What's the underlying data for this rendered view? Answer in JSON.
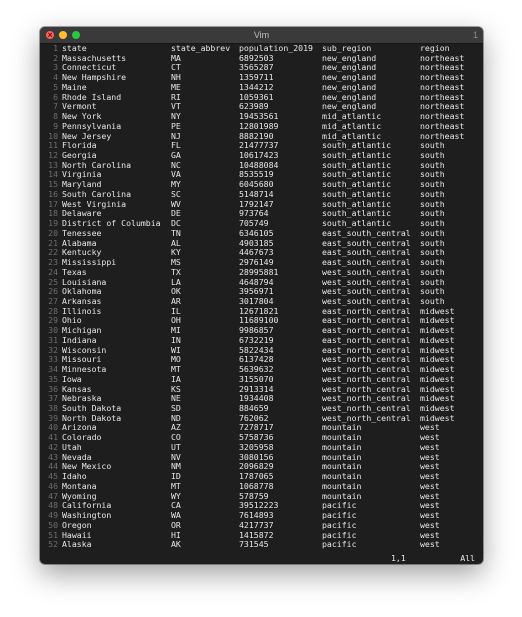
{
  "window": {
    "title": "Vim",
    "tab_number": "1"
  },
  "buffer": {
    "lines": [
      [
        "state",
        "state_abbrev",
        "population_2019",
        "sub_region",
        "region"
      ],
      [
        "Massachusetts",
        "MA",
        "6892503",
        "new_england",
        "northeast"
      ],
      [
        "Connecticut",
        "CT",
        "3565287",
        "new_england",
        "northeast"
      ],
      [
        "New Hampshire",
        "NH",
        "1359711",
        "new_england",
        "northeast"
      ],
      [
        "Maine",
        "ME",
        "1344212",
        "new_england",
        "northeast"
      ],
      [
        "Rhode Island",
        "RI",
        "1059361",
        "new_england",
        "northeast"
      ],
      [
        "Vermont",
        "VT",
        "623989",
        "new_england",
        "northeast"
      ],
      [
        "New York",
        "NY",
        "19453561",
        "mid_atlantic",
        "northeast"
      ],
      [
        "Pennsylvania",
        "PE",
        "12801989",
        "mid_atlantic",
        "northeast"
      ],
      [
        "New Jersey",
        "NJ",
        "8882190",
        "mid_atlantic",
        "northeast"
      ],
      [
        "Florida",
        "FL",
        "21477737",
        "south_atlantic",
        "south"
      ],
      [
        "Georgia",
        "GA",
        "10617423",
        "south_atlantic",
        "south"
      ],
      [
        "North Carolina",
        "NC",
        "10488084",
        "south_atlantic",
        "south"
      ],
      [
        "Virginia",
        "VA",
        "8535519",
        "south_atlantic",
        "south"
      ],
      [
        "Maryland",
        "MY",
        "6045680",
        "south_atlantic",
        "south"
      ],
      [
        "South Carolina",
        "SC",
        "5148714",
        "south_atlantic",
        "south"
      ],
      [
        "West Virginia",
        "WV",
        "1792147",
        "south_atlantic",
        "south"
      ],
      [
        "Delaware",
        "DE",
        "973764",
        "south_atlantic",
        "south"
      ],
      [
        "District of Columbia",
        "DC",
        "705749",
        "south_atlantic",
        "south"
      ],
      [
        "Tenessee",
        "TN",
        "6346105",
        "east_south_central",
        "south"
      ],
      [
        "Alabama",
        "AL",
        "4903185",
        "east_south_central",
        "south"
      ],
      [
        "Kentucky",
        "KY",
        "4467673",
        "east_south_central",
        "south"
      ],
      [
        "Mississippi",
        "MS",
        "2976149",
        "east_south_central",
        "south"
      ],
      [
        "Texas",
        "TX",
        "28995881",
        "west_south_central",
        "south"
      ],
      [
        "Louisiana",
        "LA",
        "4648794",
        "west_south_central",
        "south"
      ],
      [
        "Oklahoma",
        "OK",
        "3956971",
        "west_south_central",
        "south"
      ],
      [
        "Arkansas",
        "AR",
        "3017804",
        "west_south_central",
        "south"
      ],
      [
        "Illinois",
        "IL",
        "12671821",
        "east_north_central",
        "midwest"
      ],
      [
        "Ohio",
        "OH",
        "11689100",
        "east_north_central",
        "midwest"
      ],
      [
        "Michigan",
        "MI",
        "9986857",
        "east_north_central",
        "midwest"
      ],
      [
        "Indiana",
        "IN",
        "6732219",
        "east_north_central",
        "midwest"
      ],
      [
        "Wisconsin",
        "WI",
        "5822434",
        "east_north_central",
        "midwest"
      ],
      [
        "Missouri",
        "MO",
        "6137428",
        "west_north_central",
        "midwest"
      ],
      [
        "Minnesota",
        "MT",
        "5639632",
        "west_north_central",
        "midwest"
      ],
      [
        "Iowa",
        "IA",
        "3155070",
        "west_north_central",
        "midwest"
      ],
      [
        "Kansas",
        "KS",
        "2913314",
        "west_north_central",
        "midwest"
      ],
      [
        "Nebraska",
        "NE",
        "1934408",
        "west_north_central",
        "midwest"
      ],
      [
        "South Dakota",
        "SD",
        "884659",
        "west_north_central",
        "midwest"
      ],
      [
        "North Dakota",
        "ND",
        "762062",
        "west_north_central",
        "midwest"
      ],
      [
        "Arizona",
        "AZ",
        "7278717",
        "mountain",
        "west"
      ],
      [
        "Colorado",
        "CO",
        "5758736",
        "mountain",
        "west"
      ],
      [
        "Utah",
        "UT",
        "3205958",
        "mountain",
        "west"
      ],
      [
        "Nevada",
        "NV",
        "3080156",
        "mountain",
        "west"
      ],
      [
        "New Mexico",
        "NM",
        "2096829",
        "mountain",
        "west"
      ],
      [
        "Idaho",
        "ID",
        "1787065",
        "mountain",
        "west"
      ],
      [
        "Montana",
        "MT",
        "1068778",
        "mountain",
        "west"
      ],
      [
        "Wyoming",
        "WY",
        "578759",
        "mountain",
        "west"
      ],
      [
        "California",
        "CA",
        "39512223",
        "pacific",
        "west"
      ],
      [
        "Washington",
        "WA",
        "7614893",
        "pacific",
        "west"
      ],
      [
        "Oregon",
        "OR",
        "4217737",
        "pacific",
        "west"
      ],
      [
        "Hawaii",
        "HI",
        "1415872",
        "pacific",
        "west"
      ],
      [
        "Alaska",
        "AK",
        "731545",
        "pacific",
        "west"
      ]
    ]
  },
  "status": {
    "cursor": "1,1",
    "scroll": "All"
  },
  "colors": {
    "background": "#1e1e1e",
    "text": "#e8e8e8",
    "line_number": "#6e6e6e",
    "titlebar": "#3a3a3a",
    "close": "#ff5f57",
    "minimize": "#febc2e",
    "maximize": "#28c840"
  }
}
